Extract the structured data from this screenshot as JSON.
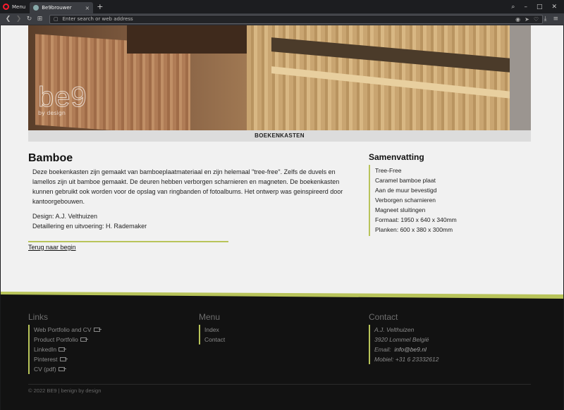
{
  "browser": {
    "menu_label": "Menu",
    "tab_title": "Be9brouwer",
    "tab_close": "×",
    "new_tab": "+",
    "address_placeholder": "Enter search or web address",
    "icons": [
      "back-icon",
      "forward-icon",
      "reload-icon",
      "speed-dial-icon",
      "camera-icon",
      "send-icon",
      "download-icon",
      "easy-setup-icon",
      "search-icon",
      "minimize-icon",
      "maximize-icon",
      "close-icon"
    ]
  },
  "hero": {
    "logo_text": "be9",
    "logo_tagline": "by design",
    "caption": "BOEKENKASTEN"
  },
  "content": {
    "title": "Bamboe",
    "paragraph": "Deze boekenkasten zijn gemaakt van bamboeplaatmateriaal en zijn helemaal \"tree-free\". Zelfs de duvels en lamellos zijn uit bamboe gemaakt. De deuren hebben verborgen scharnieren en magneten. De boekenkasten kunnen gebruikt ook worden voor de opslag van ringbanden of fotoalbums. Het ontwerp was geinspireerd door kantoorgebouwen.",
    "design_credit": "Design: A.J. Velthuizen",
    "execution_credit": "Detaillering en uitvoering: H. Rademaker",
    "back_link": "Terug naar begin"
  },
  "summary": {
    "title": "Samenvatting",
    "items": [
      "Tree-Free",
      "Caramel bamboe plaat",
      "Aan de muur bevestigd",
      "Verborgen scharnieren",
      "Magneet sluitingen",
      "Formaat: 1950 x 640 x 340mm",
      "Planken: 600 x 380 x 300mm"
    ]
  },
  "footer": {
    "links_title": "Links",
    "links": [
      "Web Portfolio and CV",
      "Product Portfolio",
      "LinkedIn",
      "Pinterest",
      "CV (pdf)"
    ],
    "menu_title": "Menu",
    "menu": [
      "Index",
      "Contact"
    ],
    "contact_title": "Contact",
    "contact_name": "A.J. Velthuizen",
    "contact_city": "3920 Lommel België",
    "contact_email_label": "Email:",
    "contact_email": "info@be9.nl",
    "contact_mobile": "Mobiel: +31 6 23332612",
    "copyright": "© 2022 BE9 | benign by design"
  },
  "colors": {
    "accent": "#b8c45a",
    "footer_bg": "#121212",
    "page_bg": "#f1f1f1"
  }
}
